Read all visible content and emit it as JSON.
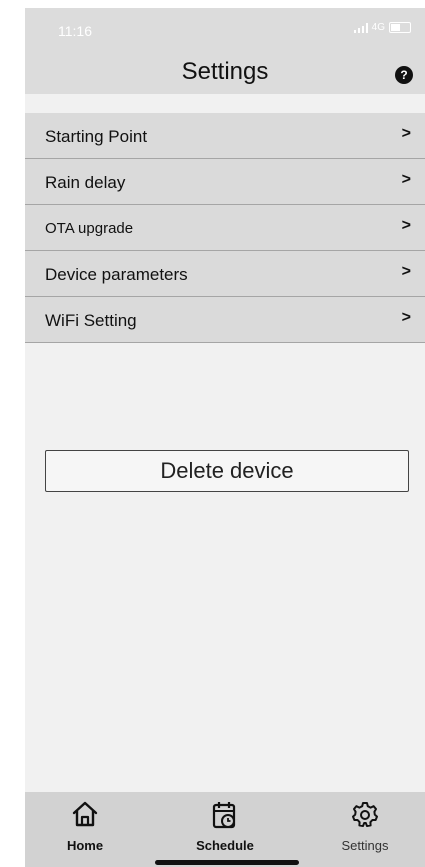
{
  "status_bar": {
    "time": "11:16",
    "network": "4G"
  },
  "header": {
    "title": "Settings",
    "help_label": "?"
  },
  "menu": {
    "items": [
      {
        "label": "Starting Point",
        "chevron": ">"
      },
      {
        "label": "Rain delay",
        "chevron": ">"
      },
      {
        "label": "OTA upgrade",
        "chevron": ">"
      },
      {
        "label": "Device parameters",
        "chevron": ">"
      },
      {
        "label": "WiFi Setting",
        "chevron": ">"
      }
    ]
  },
  "actions": {
    "delete_label": "Delete device"
  },
  "tabbar": {
    "tabs": [
      {
        "label": "Home",
        "icon": "home-icon"
      },
      {
        "label": "Schedule",
        "icon": "calendar-clock-icon"
      },
      {
        "label": "Settings",
        "icon": "gear-icon"
      }
    ],
    "active": "Settings"
  }
}
